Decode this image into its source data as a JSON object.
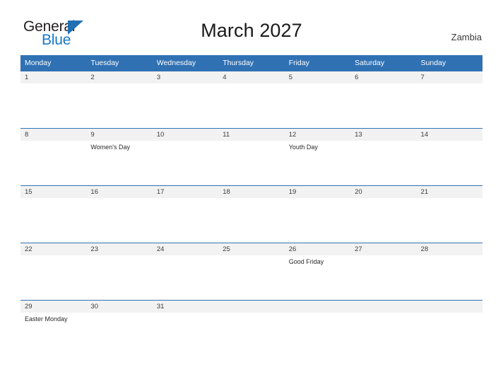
{
  "brand": {
    "name_part1": "General",
    "name_part2": "Blue",
    "flag_icon": "blue-triangle-flag",
    "accent_color": "#1878c8"
  },
  "header": {
    "title": "March 2027",
    "country": "Zambia"
  },
  "theme": {
    "header_blue": "#3071b3",
    "band_gray": "#f2f2f2",
    "text_color": "#262626"
  },
  "calendar": {
    "weekday_headers": [
      "Monday",
      "Tuesday",
      "Wednesday",
      "Thursday",
      "Friday",
      "Saturday",
      "Sunday"
    ],
    "weeks": [
      [
        {
          "day": "1",
          "event": ""
        },
        {
          "day": "2",
          "event": ""
        },
        {
          "day": "3",
          "event": ""
        },
        {
          "day": "4",
          "event": ""
        },
        {
          "day": "5",
          "event": ""
        },
        {
          "day": "6",
          "event": ""
        },
        {
          "day": "7",
          "event": ""
        }
      ],
      [
        {
          "day": "8",
          "event": ""
        },
        {
          "day": "9",
          "event": "Women's Day"
        },
        {
          "day": "10",
          "event": ""
        },
        {
          "day": "11",
          "event": ""
        },
        {
          "day": "12",
          "event": "Youth Day"
        },
        {
          "day": "13",
          "event": ""
        },
        {
          "day": "14",
          "event": ""
        }
      ],
      [
        {
          "day": "15",
          "event": ""
        },
        {
          "day": "16",
          "event": ""
        },
        {
          "day": "17",
          "event": ""
        },
        {
          "day": "18",
          "event": ""
        },
        {
          "day": "19",
          "event": ""
        },
        {
          "day": "20",
          "event": ""
        },
        {
          "day": "21",
          "event": ""
        }
      ],
      [
        {
          "day": "22",
          "event": ""
        },
        {
          "day": "23",
          "event": ""
        },
        {
          "day": "24",
          "event": ""
        },
        {
          "day": "25",
          "event": ""
        },
        {
          "day": "26",
          "event": "Good Friday"
        },
        {
          "day": "27",
          "event": ""
        },
        {
          "day": "28",
          "event": ""
        }
      ],
      [
        {
          "day": "29",
          "event": "Easter Monday"
        },
        {
          "day": "30",
          "event": ""
        },
        {
          "day": "31",
          "event": ""
        },
        {
          "day": "",
          "event": ""
        },
        {
          "day": "",
          "event": ""
        },
        {
          "day": "",
          "event": ""
        },
        {
          "day": "",
          "event": ""
        }
      ]
    ]
  }
}
